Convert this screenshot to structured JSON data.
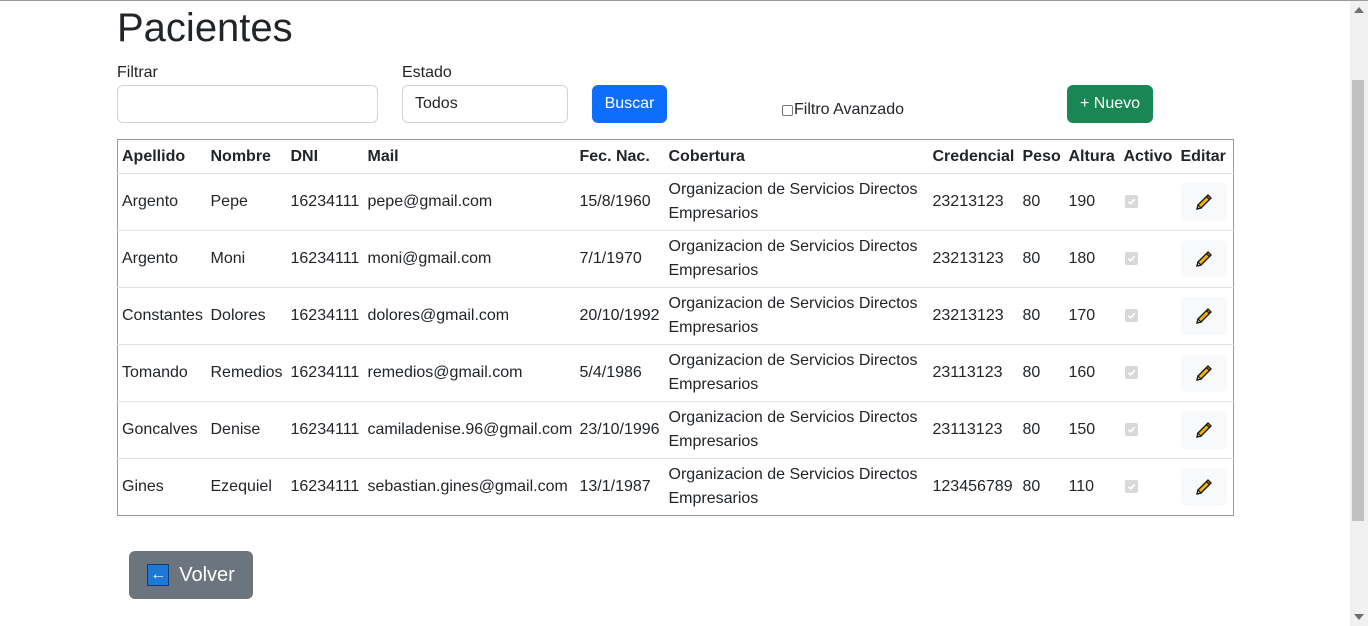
{
  "page": {
    "title": "Pacientes"
  },
  "filters": {
    "filter_label": "Filtrar",
    "filter_value": "",
    "status_label": "Estado",
    "status_value": "Todos",
    "search_button": "Buscar",
    "advanced_label": "Filtro Avanzado",
    "advanced_checked": false,
    "new_button": "+ Nuevo"
  },
  "table": {
    "headers": [
      "Apellido",
      "Nombre",
      "DNI",
      "Mail",
      "Fec. Nac.",
      "Cobertura",
      "Credencial",
      "Peso",
      "Altura",
      "Activo",
      "Editar"
    ],
    "rows": [
      {
        "apellido": "Argento",
        "nombre": "Pepe",
        "dni": "16234111",
        "mail": "pepe@gmail.com",
        "fec_nac": "15/8/1960",
        "cobertura": "Organizacion de Servicios Directos Empresarios",
        "credencial": "23213123",
        "peso": "80",
        "altura": "190",
        "activo": true
      },
      {
        "apellido": "Argento",
        "nombre": "Moni",
        "dni": "16234111",
        "mail": "moni@gmail.com",
        "fec_nac": "7/1/1970",
        "cobertura": "Organizacion de Servicios Directos Empresarios",
        "credencial": "23213123",
        "peso": "80",
        "altura": "180",
        "activo": true
      },
      {
        "apellido": "Constantes",
        "nombre": "Dolores",
        "dni": "16234111",
        "mail": "dolores@gmail.com",
        "fec_nac": "20/10/1992",
        "cobertura": "Organizacion de Servicios Directos Empresarios",
        "credencial": "23213123",
        "peso": "80",
        "altura": "170",
        "activo": true
      },
      {
        "apellido": "Tomando",
        "nombre": "Remedios",
        "dni": "16234111",
        "mail": "remedios@gmail.com",
        "fec_nac": "5/4/1986",
        "cobertura": "Organizacion de Servicios Directos Empresarios",
        "credencial": "23113123",
        "peso": "80",
        "altura": "160",
        "activo": true
      },
      {
        "apellido": "Goncalves",
        "nombre": "Denise",
        "dni": "16234111",
        "mail": "camiladenise.96@gmail.com",
        "fec_nac": "23/10/1996",
        "cobertura": "Organizacion de Servicios Directos Empresarios",
        "credencial": "23113123",
        "peso": "80",
        "altura": "150",
        "activo": true
      },
      {
        "apellido": "Gines",
        "nombre": "Ezequiel",
        "dni": "16234111",
        "mail": "sebastian.gines@gmail.com",
        "fec_nac": "13/1/1987",
        "cobertura": "Organizacion de Servicios Directos Empresarios",
        "credencial": "123456789",
        "peso": "80",
        "altura": "110",
        "activo": true
      }
    ]
  },
  "footer": {
    "back_button": "Volver"
  },
  "colors": {
    "primary": "#0d6efd",
    "success": "#198754",
    "secondary": "#6c757d",
    "pencil": "#f5b400"
  },
  "icons": {
    "edit": "pencil-icon",
    "back": "left-arrow-icon",
    "check": "checkbox-checked-icon"
  }
}
